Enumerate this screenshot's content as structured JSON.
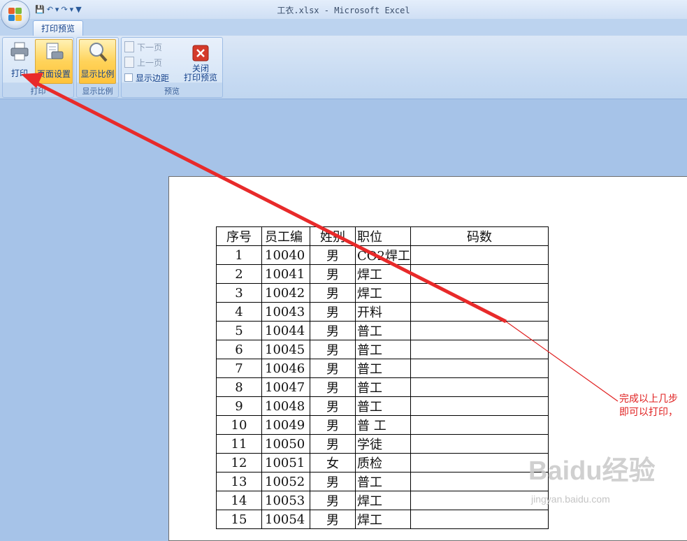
{
  "window": {
    "title": "工衣.xlsx - Microsoft Excel"
  },
  "tabs": [
    {
      "label": "打印预览"
    }
  ],
  "ribbon": {
    "print_group": {
      "label": "打印",
      "print_button": "打印",
      "page_setup_button": "页面设置"
    },
    "zoom_group": {
      "label": "显示比例",
      "zoom_button": "显示比例"
    },
    "preview_group": {
      "label": "预览",
      "next_page": "下一页",
      "prev_page": "上一页",
      "show_margins": "显示边距",
      "close_preview_line1": "关闭",
      "close_preview_line2": "打印预览"
    }
  },
  "sheet": {
    "headers": [
      "序号",
      "员工编",
      "姓别",
      "职位",
      "码数"
    ],
    "rows": [
      [
        "1",
        "10040",
        "男",
        "CO2焊工",
        ""
      ],
      [
        "2",
        "10041",
        "男",
        "焊工",
        ""
      ],
      [
        "3",
        "10042",
        "男",
        "焊工",
        ""
      ],
      [
        "4",
        "10043",
        "男",
        "开料",
        ""
      ],
      [
        "5",
        "10044",
        "男",
        "普工",
        ""
      ],
      [
        "6",
        "10045",
        "男",
        "普工",
        ""
      ],
      [
        "7",
        "10046",
        "男",
        "普工",
        ""
      ],
      [
        "8",
        "10047",
        "男",
        "普工",
        ""
      ],
      [
        "9",
        "10048",
        "男",
        "普工",
        ""
      ],
      [
        "10",
        "10049",
        "男",
        "普 工",
        ""
      ],
      [
        "11",
        "10050",
        "男",
        "学徒",
        ""
      ],
      [
        "12",
        "10051",
        "女",
        "质检",
        ""
      ],
      [
        "13",
        "10052",
        "男",
        "普工",
        ""
      ],
      [
        "14",
        "10053",
        "男",
        "焊工",
        ""
      ],
      [
        "15",
        "10054",
        "男",
        "焊工",
        ""
      ]
    ]
  },
  "annotation": {
    "line1": "完成以上几步",
    "line2": "即可以打印，",
    "color": "#e02020"
  },
  "watermark": {
    "brand": "Baidu经验",
    "url": "jingyan.baidu.com"
  },
  "colors": {
    "ribbon_bg": "#c6daf2",
    "workspace_bg": "#a6c3e8",
    "highlight": "#ffd35a"
  }
}
